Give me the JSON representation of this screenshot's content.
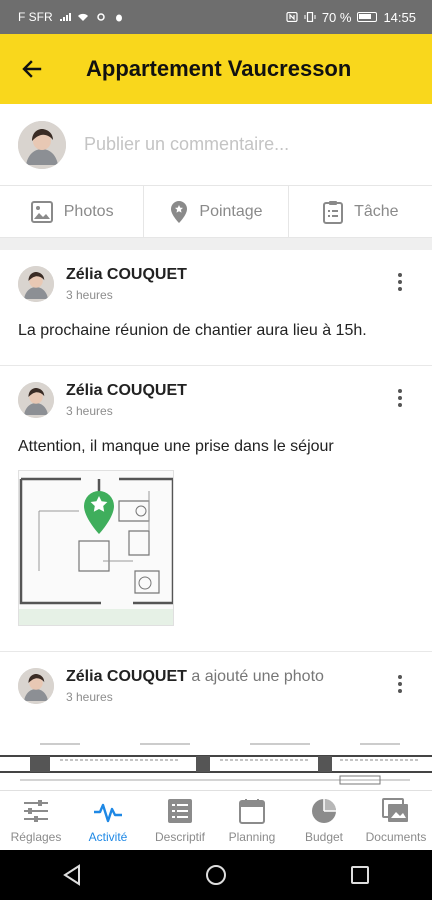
{
  "status": {
    "carrier": "F SFR",
    "battery_percent": "70 %",
    "time": "14:55"
  },
  "header": {
    "title": "Appartement Vaucresson",
    "back_icon": "back-arrow-icon"
  },
  "composer": {
    "placeholder": "Publier un commentaire..."
  },
  "actions": [
    {
      "label": "Photos",
      "icon": "image-icon"
    },
    {
      "label": "Pointage",
      "icon": "map-pin-icon"
    },
    {
      "label": "Tâche",
      "icon": "clipboard-icon"
    }
  ],
  "posts": [
    {
      "author": "Zélia COUQUET",
      "action": "",
      "time": "3 heures",
      "text": "La prochaine réunion de chantier aura lieu à 15h."
    },
    {
      "author": "Zélia COUQUET",
      "action": "",
      "time": "3 heures",
      "text": "Attention, il manque une prise dans le séjour"
    },
    {
      "author": "Zélia COUQUET",
      "action": " a ajouté une photo",
      "time": "3 heures",
      "text": ""
    }
  ],
  "nav": {
    "active": "Activité",
    "tabs": [
      {
        "label": "Réglages",
        "icon": "sliders-icon"
      },
      {
        "label": "Activité",
        "icon": "pulse-icon"
      },
      {
        "label": "Descriptif",
        "icon": "list-icon"
      },
      {
        "label": "Planning",
        "icon": "calendar-icon"
      },
      {
        "label": "Budget",
        "icon": "pie-chart-icon"
      },
      {
        "label": "Documents",
        "icon": "documents-icon"
      }
    ]
  },
  "colors": {
    "accent": "#f9d71c",
    "active_tab": "#1e88e5",
    "pin": "#3fae5c"
  }
}
